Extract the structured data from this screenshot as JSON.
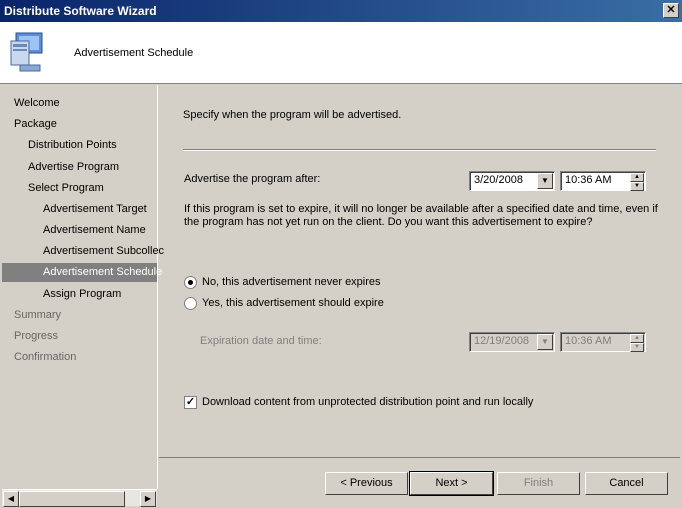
{
  "window": {
    "title": "Distribute Software Wizard",
    "close_label": "✕"
  },
  "header": {
    "title": "Advertisement Schedule",
    "icon": "computer-monitor-icon"
  },
  "nav": {
    "items": [
      {
        "label": "Welcome",
        "state": "normal"
      },
      {
        "label": "Package",
        "state": "normal"
      },
      {
        "label": "Distribution Points",
        "state": "normal"
      },
      {
        "label": "Advertise Program",
        "state": "normal"
      },
      {
        "label": "Select Program",
        "state": "normal"
      },
      {
        "label": "Advertisement Target",
        "state": "normal"
      },
      {
        "label": "Advertisement Name",
        "state": "normal"
      },
      {
        "label": "Advertisement Subcollec",
        "state": "normal"
      },
      {
        "label": "Advertisement Schedule",
        "state": "selected"
      },
      {
        "label": "Assign Program",
        "state": "normal"
      },
      {
        "label": "Summary",
        "state": "dim"
      },
      {
        "label": "Progress",
        "state": "dim"
      },
      {
        "label": "Confirmation",
        "state": "dim"
      }
    ]
  },
  "main": {
    "intro": "Specify when the program will be advertised.",
    "advertise_after_label": "Advertise the program after:",
    "advertise_date": "3/20/2008",
    "advertise_time": "10:36 AM",
    "expire_question_line1": "If this program is set to expire, it will no longer be available after a specified date and time, even if",
    "expire_question_line2": "the program has not yet run on the client. Do you want this advertisement to expire?",
    "radio_never": "No, this advertisement never expires",
    "radio_expire": "Yes, this advertisement should expire",
    "selected_option": "never",
    "expiration_label": "Expiration date and time:",
    "expiration_date": "12/19/2008",
    "expiration_time": "10:36 AM",
    "download_checkbox": "Download content from unprotected distribution point and run locally",
    "download_checked": true
  },
  "buttons": {
    "previous": "< Previous",
    "next": "Next >",
    "finish": "Finish",
    "cancel": "Cancel"
  }
}
